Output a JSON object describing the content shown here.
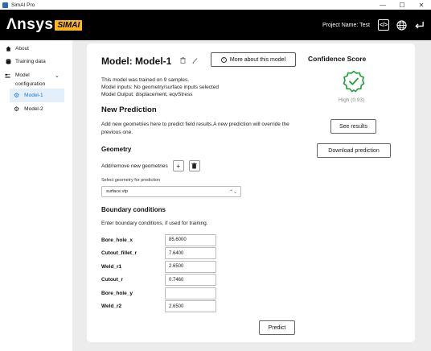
{
  "window": {
    "title": "SimAI Pro",
    "controls": [
      "—",
      "☐",
      "✕"
    ]
  },
  "header": {
    "logo_word": "Λnsys",
    "logo_badge": "SIMAI",
    "project_label": "Project Name: Test",
    "code_icon_text": "</>"
  },
  "sidebar": {
    "about": "About",
    "training_data": "Training data",
    "model_configuration": "Model configuration",
    "models": [
      "Model-1",
      "Model-2"
    ]
  },
  "model": {
    "title": "Model: Model-1",
    "about_button": "More about this model",
    "info_lines": [
      "This model was trained on 9 samples.",
      "Model inputs: No geometry/surface inputs selected",
      "Model Output: displacement, eqvStress"
    ]
  },
  "new_prediction": {
    "heading": "New Prediction",
    "description": "Add new geometries here to predict field results.A new prediction will override the previous one."
  },
  "geometry": {
    "heading": "Geometry",
    "add_remove_label": "Add/remove new geometries",
    "add_symbol": "+",
    "select_label": "Select geometry for prediction",
    "selected_value": "surface.vtp"
  },
  "boundary": {
    "heading": "Boundary conditions",
    "description": "Enter boundary conditions, if used for training.",
    "rows": [
      {
        "name": "Bore_hole_x",
        "value": "85.6000"
      },
      {
        "name": "Cutout_fillet_r",
        "value": "7.6400"
      },
      {
        "name": "Weld_r1",
        "value": "2.6500"
      },
      {
        "name": "Cutout_r",
        "value": "0.7460"
      },
      {
        "name": "Bore_hole_y",
        "value": ""
      },
      {
        "name": "Weld_r2",
        "value": "2.6500"
      }
    ]
  },
  "predict_button": "Predict",
  "confidence": {
    "heading": "Confidence Score",
    "value": "High (0.93)",
    "color": "#1f9e3e",
    "see_results": "See results",
    "download": "Download prediction"
  }
}
